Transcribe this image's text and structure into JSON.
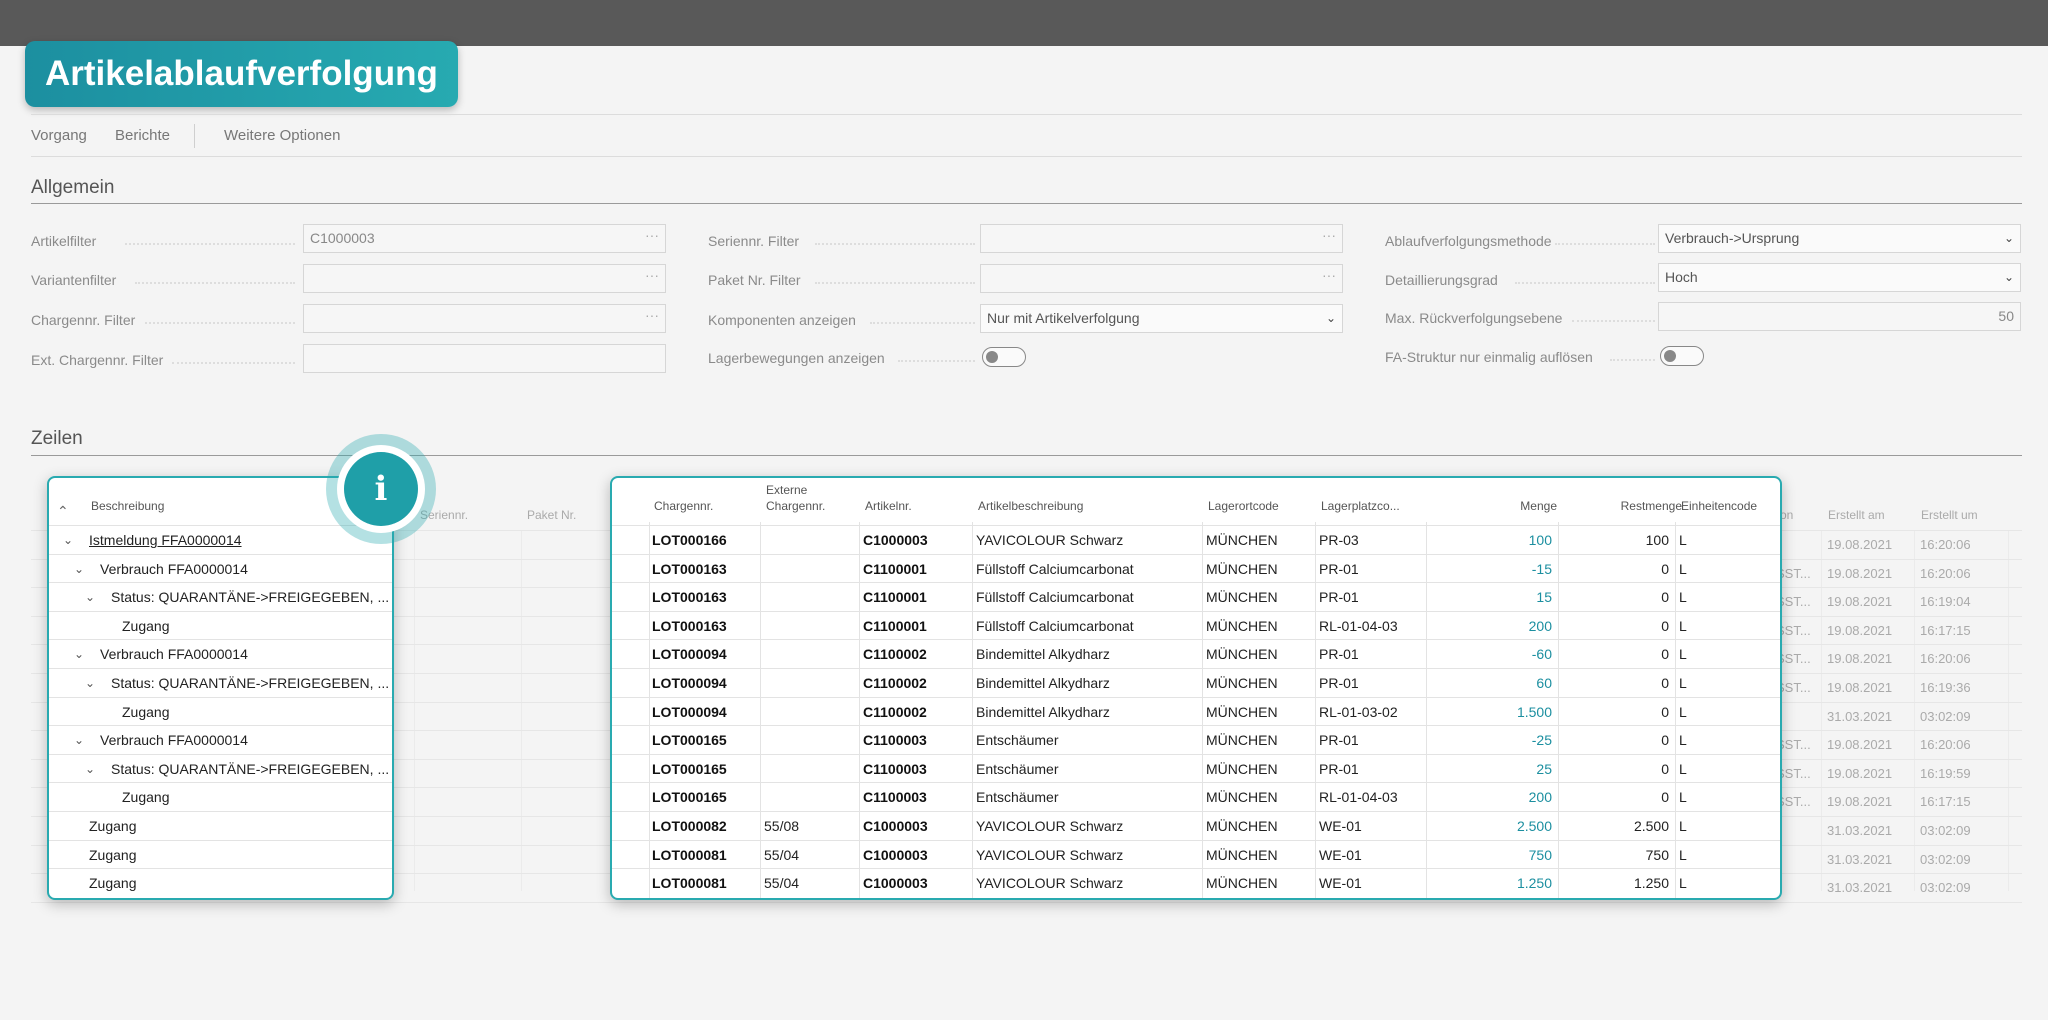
{
  "page_title": "Artikelablaufverfolgung",
  "actions": {
    "vorgang": "Vorgang",
    "berichte": "Berichte",
    "weitere": "Weitere Optionen"
  },
  "general": {
    "title": "Allgemein",
    "artikelfilter_label": "Artikelfilter",
    "artikelfilter_value": "C1000003",
    "variantenfilter_label": "Variantenfilter",
    "chargennr_filter_label": "Chargennr. Filter",
    "ext_chargennr_filter_label": "Ext. Chargennr. Filter",
    "seriennr_filter_label": "Seriennr. Filter",
    "paket_nr_filter_label": "Paket Nr. Filter",
    "komponenten_label": "Komponenten anzeigen",
    "komponenten_value": "Nur mit Artikelverfolgung",
    "lagerbewegungen_label": "Lagerbewegungen anzeigen",
    "methode_label": "Ablaufverfolgungsmethode",
    "methode_value": "Verbrauch->Ursprung",
    "detail_label": "Detaillierungsgrad",
    "detail_value": "Hoch",
    "max_label": "Max. Rückverfolgungsebene",
    "max_value": "50",
    "fa_label": "FA-Struktur nur einmalig auflösen",
    "ellipsis": "···"
  },
  "lines": {
    "title": "Zeilen",
    "bg_headers": {
      "seriennr": "Seriennr.",
      "paket": "Paket Nr.",
      "on": "on",
      "erstellt_am": "Erstellt am",
      "erstellt_um": "Erstellt um"
    },
    "tree_header": "Beschreibung",
    "tree_rows": [
      {
        "indent": 0,
        "chev": "down",
        "label": "Istmeldung FFA0000014",
        "link": true
      },
      {
        "indent": 1,
        "chev": "down",
        "label": "Verbrauch FFA0000014"
      },
      {
        "indent": 2,
        "chev": "down",
        "label": "Status: QUARANTÄNE->FREIGEGEBEN, ..."
      },
      {
        "indent": 3,
        "chev": "",
        "label": "Zugang"
      },
      {
        "indent": 1,
        "chev": "down",
        "label": "Verbrauch FFA0000014"
      },
      {
        "indent": 2,
        "chev": "down",
        "label": "Status: QUARANTÄNE->FREIGEGEBEN, ..."
      },
      {
        "indent": 3,
        "chev": "",
        "label": "Zugang"
      },
      {
        "indent": 1,
        "chev": "down",
        "label": "Verbrauch FFA0000014"
      },
      {
        "indent": 2,
        "chev": "down",
        "label": "Status: QUARANTÄNE->FREIGEGEBEN, ..."
      },
      {
        "indent": 3,
        "chev": "",
        "label": "Zugang"
      },
      {
        "indent": 0,
        "chev": "",
        "label": "Zugang"
      },
      {
        "indent": 0,
        "chev": "",
        "label": "Zugang"
      },
      {
        "indent": 0,
        "chev": "",
        "label": "Zugang"
      }
    ],
    "headers": {
      "chargennr": "Chargennr.",
      "externe1": "Externe",
      "externe2": "Chargennr.",
      "artikelnr": "Artikelnr.",
      "beschreibung": "Artikelbeschreibung",
      "lagerort": "Lagerortcode",
      "lagerplatz": "Lagerplatzco...",
      "menge": "Menge",
      "restmenge": "Restmenge",
      "einheit": "Einheitencode"
    },
    "rows": [
      {
        "charge": "LOT000166",
        "ext": "",
        "artikel": "C1000003",
        "beschr": "YAVICOLOUR Schwarz",
        "lagerort": "MÜNCHEN",
        "platz": "PR-03",
        "menge": "100",
        "rest": "100",
        "einheit": "L",
        "bg_code": "",
        "am": "19.08.2021",
        "um": "16:20:06"
      },
      {
        "charge": "LOT000163",
        "ext": "",
        "artikel": "C1100001",
        "beschr": "Füllstoff Calciumcarbonat",
        "lagerort": "MÜNCHEN",
        "platz": "PR-01",
        "menge": "-15",
        "rest": "0",
        "einheit": "L",
        "bg_code": "SST...",
        "am": "19.08.2021",
        "um": "16:20:06"
      },
      {
        "charge": "LOT000163",
        "ext": "",
        "artikel": "C1100001",
        "beschr": "Füllstoff Calciumcarbonat",
        "lagerort": "MÜNCHEN",
        "platz": "PR-01",
        "menge": "15",
        "rest": "0",
        "einheit": "L",
        "bg_code": "SST...",
        "am": "19.08.2021",
        "um": "16:19:04"
      },
      {
        "charge": "LOT000163",
        "ext": "",
        "artikel": "C1100001",
        "beschr": "Füllstoff Calciumcarbonat",
        "lagerort": "MÜNCHEN",
        "platz": "RL-01-04-03",
        "menge": "200",
        "rest": "0",
        "einheit": "L",
        "bg_code": "SST...",
        "am": "19.08.2021",
        "um": "16:17:15"
      },
      {
        "charge": "LOT000094",
        "ext": "",
        "artikel": "C1100002",
        "beschr": "Bindemittel Alkydharz",
        "lagerort": "MÜNCHEN",
        "platz": "PR-01",
        "menge": "-60",
        "rest": "0",
        "einheit": "L",
        "bg_code": "SST...",
        "am": "19.08.2021",
        "um": "16:20:06"
      },
      {
        "charge": "LOT000094",
        "ext": "",
        "artikel": "C1100002",
        "beschr": "Bindemittel Alkydharz",
        "lagerort": "MÜNCHEN",
        "platz": "PR-01",
        "menge": "60",
        "rest": "0",
        "einheit": "L",
        "bg_code": "SST...",
        "am": "19.08.2021",
        "um": "16:19:36"
      },
      {
        "charge": "LOT000094",
        "ext": "",
        "artikel": "C1100002",
        "beschr": "Bindemittel Alkydharz",
        "lagerort": "MÜNCHEN",
        "platz": "RL-01-03-02",
        "menge": "1.500",
        "rest": "0",
        "einheit": "L",
        "bg_code": "",
        "am": "31.03.2021",
        "um": "03:02:09"
      },
      {
        "charge": "LOT000165",
        "ext": "",
        "artikel": "C1100003",
        "beschr": "Entschäumer",
        "lagerort": "MÜNCHEN",
        "platz": "PR-01",
        "menge": "-25",
        "rest": "0",
        "einheit": "L",
        "bg_code": "SST...",
        "am": "19.08.2021",
        "um": "16:20:06"
      },
      {
        "charge": "LOT000165",
        "ext": "",
        "artikel": "C1100003",
        "beschr": "Entschäumer",
        "lagerort": "MÜNCHEN",
        "platz": "PR-01",
        "menge": "25",
        "rest": "0",
        "einheit": "L",
        "bg_code": "SST...",
        "am": "19.08.2021",
        "um": "16:19:59"
      },
      {
        "charge": "LOT000165",
        "ext": "",
        "artikel": "C1100003",
        "beschr": "Entschäumer",
        "lagerort": "MÜNCHEN",
        "platz": "RL-01-04-03",
        "menge": "200",
        "rest": "0",
        "einheit": "L",
        "bg_code": "SST...",
        "am": "19.08.2021",
        "um": "16:17:15"
      },
      {
        "charge": "LOT000082",
        "ext": "55/08",
        "artikel": "C1000003",
        "beschr": "YAVICOLOUR Schwarz",
        "lagerort": "MÜNCHEN",
        "platz": "WE-01",
        "menge": "2.500",
        "rest": "2.500",
        "einheit": "L",
        "bg_code": "",
        "am": "31.03.2021",
        "um": "03:02:09"
      },
      {
        "charge": "LOT000081",
        "ext": "55/04",
        "artikel": "C1000003",
        "beschr": "YAVICOLOUR Schwarz",
        "lagerort": "MÜNCHEN",
        "platz": "WE-01",
        "menge": "750",
        "rest": "750",
        "einheit": "L",
        "bg_code": "",
        "am": "31.03.2021",
        "um": "03:02:09"
      },
      {
        "charge": "LOT000081",
        "ext": "55/04",
        "artikel": "C1000003",
        "beschr": "YAVICOLOUR Schwarz",
        "lagerort": "MÜNCHEN",
        "platz": "WE-01",
        "menge": "1.250",
        "rest": "1.250",
        "einheit": "L",
        "bg_code": "",
        "am": "31.03.2021",
        "um": "03:02:09"
      }
    ]
  },
  "info_icon": "i",
  "colors": {
    "accent": "#29aab0",
    "title_badge": "#1c8fa0",
    "topbar": "#595959"
  }
}
